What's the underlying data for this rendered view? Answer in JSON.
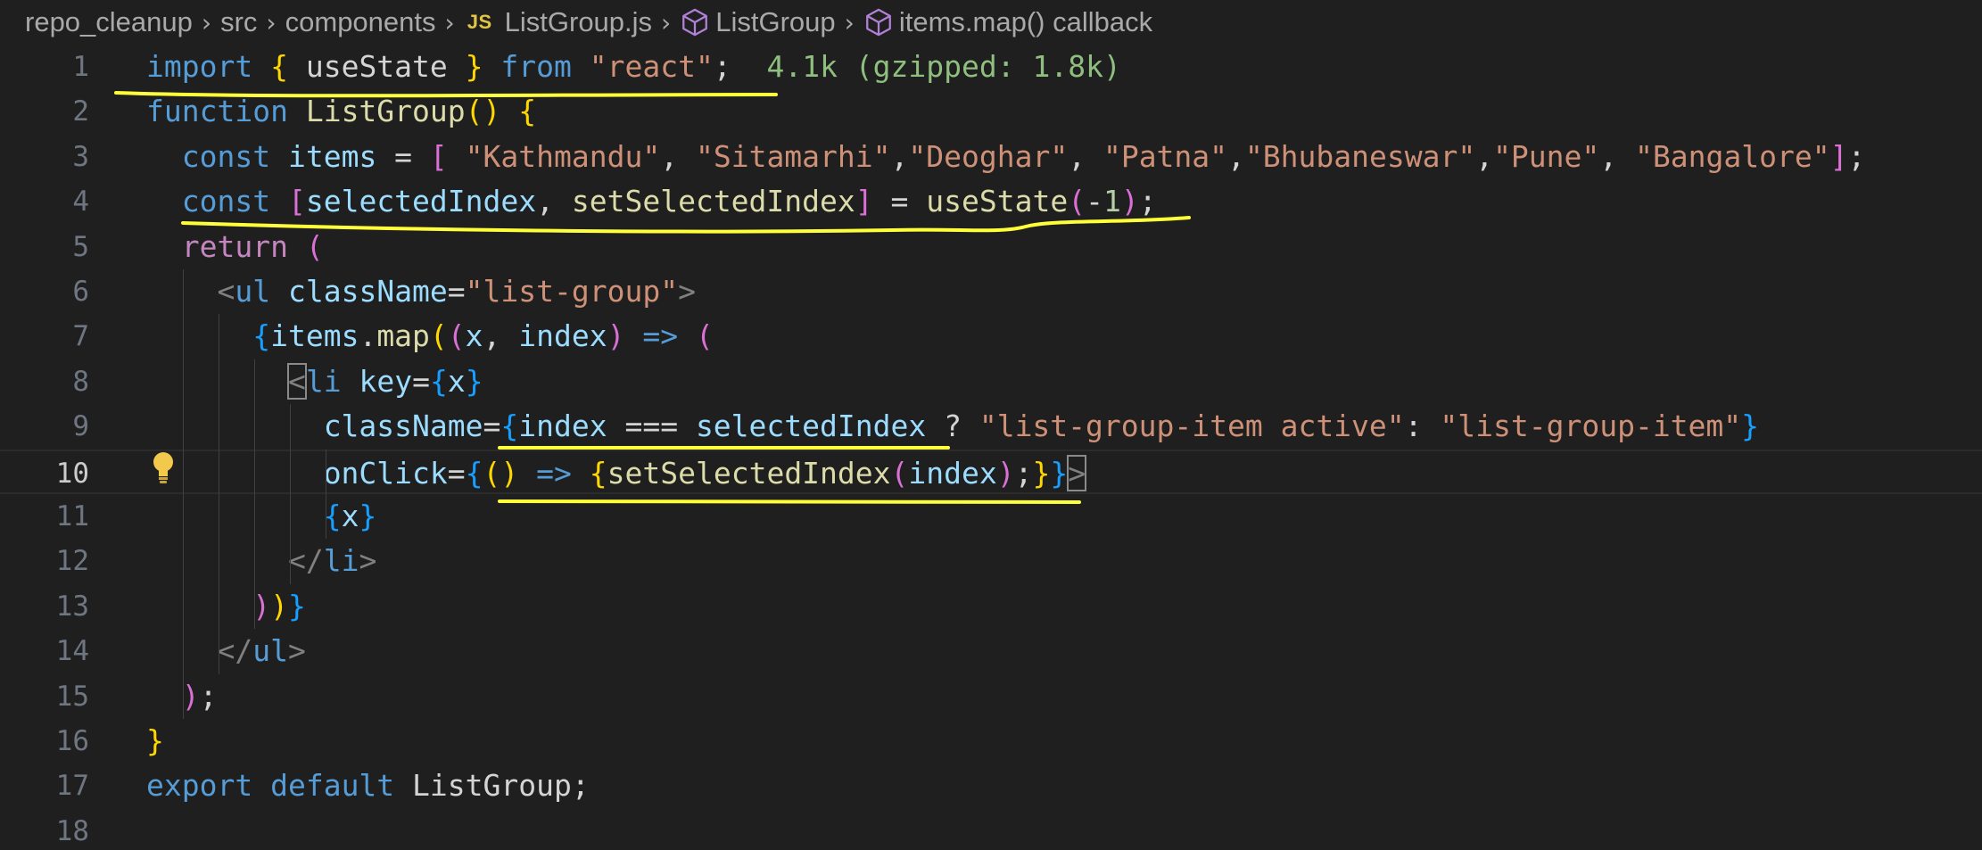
{
  "breadcrumb": {
    "items": [
      {
        "label": "repo_cleanup",
        "icon": null
      },
      {
        "label": "src",
        "icon": null
      },
      {
        "label": "components",
        "icon": null
      },
      {
        "label": "ListGroup.js",
        "icon": "js-file-icon",
        "icon_text": "JS"
      },
      {
        "label": "ListGroup",
        "icon": "symbol-cube-icon"
      },
      {
        "label": "items.map() callback",
        "icon": "symbol-cube-icon"
      }
    ],
    "separator": "›"
  },
  "editor": {
    "current_line": 10,
    "lines": [
      {
        "n": "1",
        "tokens": [
          [
            "import",
            "kw"
          ],
          [
            " ",
            "p"
          ],
          [
            "{",
            "b1"
          ],
          [
            " useState ",
            "p"
          ],
          [
            "}",
            "b1"
          ],
          [
            " ",
            "p"
          ],
          [
            "from",
            "kw"
          ],
          [
            " ",
            "p"
          ],
          [
            "\"react\"",
            "str"
          ],
          [
            ";",
            "p"
          ],
          [
            "  ",
            "p"
          ],
          [
            "4.1k (gzipped: 1.8k)",
            "hint"
          ]
        ]
      },
      {
        "n": "2",
        "tokens": [
          [
            "function",
            "kw"
          ],
          [
            " ",
            "p"
          ],
          [
            "ListGroup",
            "fn"
          ],
          [
            "()",
            "b1"
          ],
          [
            " ",
            "p"
          ],
          [
            "{",
            "b1"
          ]
        ]
      },
      {
        "n": "3",
        "tokens": [
          [
            "  ",
            "p"
          ],
          [
            "const",
            "kw"
          ],
          [
            " ",
            "p"
          ],
          [
            "items",
            "id"
          ],
          [
            " = ",
            "p"
          ],
          [
            "[",
            "b2"
          ],
          [
            " ",
            "p"
          ],
          [
            "\"Kathmandu\"",
            "str"
          ],
          [
            ", ",
            "p"
          ],
          [
            "\"Sitamarhi\"",
            "str"
          ],
          [
            ",",
            "p"
          ],
          [
            "\"Deoghar\"",
            "str"
          ],
          [
            ", ",
            "p"
          ],
          [
            "\"Patna\"",
            "str"
          ],
          [
            ",",
            "p"
          ],
          [
            "\"Bhubaneswar\"",
            "str"
          ],
          [
            ",",
            "p"
          ],
          [
            "\"Pune\"",
            "str"
          ],
          [
            ", ",
            "p"
          ],
          [
            "\"Bangalore\"",
            "str"
          ],
          [
            "]",
            "b2"
          ],
          [
            ";",
            "p"
          ]
        ]
      },
      {
        "n": "4",
        "tokens": [
          [
            "  ",
            "p"
          ],
          [
            "const",
            "kw"
          ],
          [
            " ",
            "p"
          ],
          [
            "[",
            "b2"
          ],
          [
            "selectedIndex",
            "id"
          ],
          [
            ", ",
            "p"
          ],
          [
            "setSelectedIndex",
            "fn"
          ],
          [
            "]",
            "b2"
          ],
          [
            " = ",
            "p"
          ],
          [
            "useState",
            "fn"
          ],
          [
            "(",
            "b2"
          ],
          [
            "-",
            "p"
          ],
          [
            "1",
            "num"
          ],
          [
            ")",
            "b2"
          ],
          [
            ";",
            "p"
          ]
        ]
      },
      {
        "n": "5",
        "tokens": [
          [
            "  ",
            "p"
          ],
          [
            "return",
            "ctl"
          ],
          [
            " ",
            "p"
          ],
          [
            "(",
            "b2"
          ]
        ]
      },
      {
        "n": "6",
        "tokens": [
          [
            "    ",
            "p"
          ],
          [
            "<",
            "tagp"
          ],
          [
            "ul",
            "tag"
          ],
          [
            " ",
            "p"
          ],
          [
            "className",
            "attr"
          ],
          [
            "=",
            "p"
          ],
          [
            "\"list-group\"",
            "str"
          ],
          [
            ">",
            "tagp"
          ]
        ]
      },
      {
        "n": "7",
        "tokens": [
          [
            "      ",
            "p"
          ],
          [
            "{",
            "b3"
          ],
          [
            "items",
            "id"
          ],
          [
            ".",
            "p"
          ],
          [
            "map",
            "fn"
          ],
          [
            "(",
            "b1"
          ],
          [
            "(",
            "b2"
          ],
          [
            "x",
            "id"
          ],
          [
            ", ",
            "p"
          ],
          [
            "index",
            "id"
          ],
          [
            ")",
            "b2"
          ],
          [
            " ",
            "p"
          ],
          [
            "=>",
            "kw"
          ],
          [
            " ",
            "p"
          ],
          [
            "(",
            "b2"
          ]
        ]
      },
      {
        "n": "8",
        "tokens": [
          [
            "        ",
            "p"
          ],
          [
            "<",
            "tagp-box"
          ],
          [
            "li",
            "tag"
          ],
          [
            " ",
            "p"
          ],
          [
            "key",
            "attr"
          ],
          [
            "=",
            "p"
          ],
          [
            "{",
            "b3"
          ],
          [
            "x",
            "id"
          ],
          [
            "}",
            "b3"
          ]
        ]
      },
      {
        "n": "9",
        "tokens": [
          [
            "          ",
            "p"
          ],
          [
            "className",
            "attr"
          ],
          [
            "=",
            "p"
          ],
          [
            "{",
            "b3"
          ],
          [
            "index",
            "id"
          ],
          [
            " === ",
            "p"
          ],
          [
            "selectedIndex",
            "id"
          ],
          [
            " ? ",
            "p"
          ],
          [
            "\"list-group-item active\"",
            "str"
          ],
          [
            ": ",
            "p"
          ],
          [
            "\"list-group-item\"",
            "str"
          ],
          [
            "}",
            "b3"
          ]
        ]
      },
      {
        "n": "10",
        "tokens": [
          [
            "          ",
            "p"
          ],
          [
            "onClick",
            "attr"
          ],
          [
            "=",
            "p"
          ],
          [
            "{",
            "b3"
          ],
          [
            "()",
            "b1"
          ],
          [
            " ",
            "p"
          ],
          [
            "=>",
            "kw"
          ],
          [
            " ",
            "p"
          ],
          [
            "{",
            "b1"
          ],
          [
            "setSelectedIndex",
            "fn"
          ],
          [
            "(",
            "b2"
          ],
          [
            "index",
            "id"
          ],
          [
            ")",
            "b2"
          ],
          [
            ";",
            "p"
          ],
          [
            "}",
            "b1"
          ],
          [
            "}",
            "b3"
          ],
          [
            ">",
            "tagp-box"
          ]
        ]
      },
      {
        "n": "11",
        "tokens": [
          [
            "          ",
            "p"
          ],
          [
            "{",
            "b3"
          ],
          [
            "x",
            "id"
          ],
          [
            "}",
            "b3"
          ]
        ]
      },
      {
        "n": "12",
        "tokens": [
          [
            "        ",
            "p"
          ],
          [
            "</",
            "tagp"
          ],
          [
            "li",
            "tag"
          ],
          [
            ">",
            "tagp"
          ]
        ]
      },
      {
        "n": "13",
        "tokens": [
          [
            "      ",
            "p"
          ],
          [
            ")",
            "b2"
          ],
          [
            ")",
            "b1"
          ],
          [
            "}",
            "b3"
          ]
        ]
      },
      {
        "n": "14",
        "tokens": [
          [
            "    ",
            "p"
          ],
          [
            "</",
            "tagp"
          ],
          [
            "ul",
            "tag"
          ],
          [
            ">",
            "tagp"
          ]
        ]
      },
      {
        "n": "15",
        "tokens": [
          [
            "  ",
            "p"
          ],
          [
            ")",
            "b2"
          ],
          [
            ";",
            "p"
          ]
        ]
      },
      {
        "n": "16",
        "tokens": [
          [
            "}",
            "b1"
          ]
        ]
      },
      {
        "n": "17",
        "tokens": [
          [
            "export",
            "kw"
          ],
          [
            " ",
            "p"
          ],
          [
            "default",
            "kw"
          ],
          [
            " ",
            "p"
          ],
          [
            "ListGroup",
            "p"
          ],
          [
            ";",
            "p"
          ]
        ]
      },
      {
        "n": "18",
        "tokens": []
      }
    ]
  },
  "colors": {
    "background": "#1f1f1f",
    "annotation_underline": "#ffff3a",
    "lightbulb": "#f2c94c"
  }
}
